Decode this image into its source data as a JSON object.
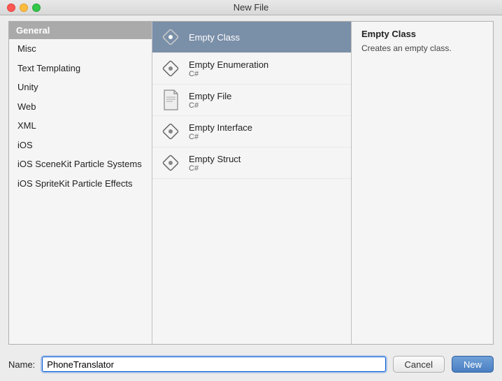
{
  "window": {
    "title": "New File"
  },
  "left_panel": {
    "header": "General",
    "categories": [
      {
        "id": "misc",
        "label": "Misc"
      },
      {
        "id": "text-templating",
        "label": "Text Templating"
      },
      {
        "id": "unity",
        "label": "Unity"
      },
      {
        "id": "web",
        "label": "Web"
      },
      {
        "id": "xml",
        "label": "XML"
      },
      {
        "id": "ios",
        "label": "iOS"
      },
      {
        "id": "ios-scenekit",
        "label": "iOS SceneKit Particle Systems"
      },
      {
        "id": "ios-spritekit",
        "label": "iOS SpriteKit Particle Effects"
      }
    ]
  },
  "middle_panel": {
    "items": [
      {
        "id": "empty-class",
        "name": "Empty Class",
        "sub": "",
        "icon": "diamond",
        "selected": true
      },
      {
        "id": "empty-enumeration",
        "name": "Empty Enumeration",
        "sub": "C#",
        "icon": "diamond",
        "selected": false
      },
      {
        "id": "empty-file",
        "name": "Empty File",
        "sub": "C#",
        "icon": "doc",
        "selected": false
      },
      {
        "id": "empty-interface",
        "name": "Empty Interface",
        "sub": "C#",
        "icon": "diamond",
        "selected": false
      },
      {
        "id": "empty-struct",
        "name": "Empty Struct",
        "sub": "C#",
        "icon": "diamond",
        "selected": false
      }
    ]
  },
  "right_panel": {
    "title": "Empty Class",
    "description": "Creates an empty class."
  },
  "bottom": {
    "name_label": "Name:",
    "name_value": "PhoneTranslator",
    "cancel_label": "Cancel",
    "new_label": "New"
  }
}
